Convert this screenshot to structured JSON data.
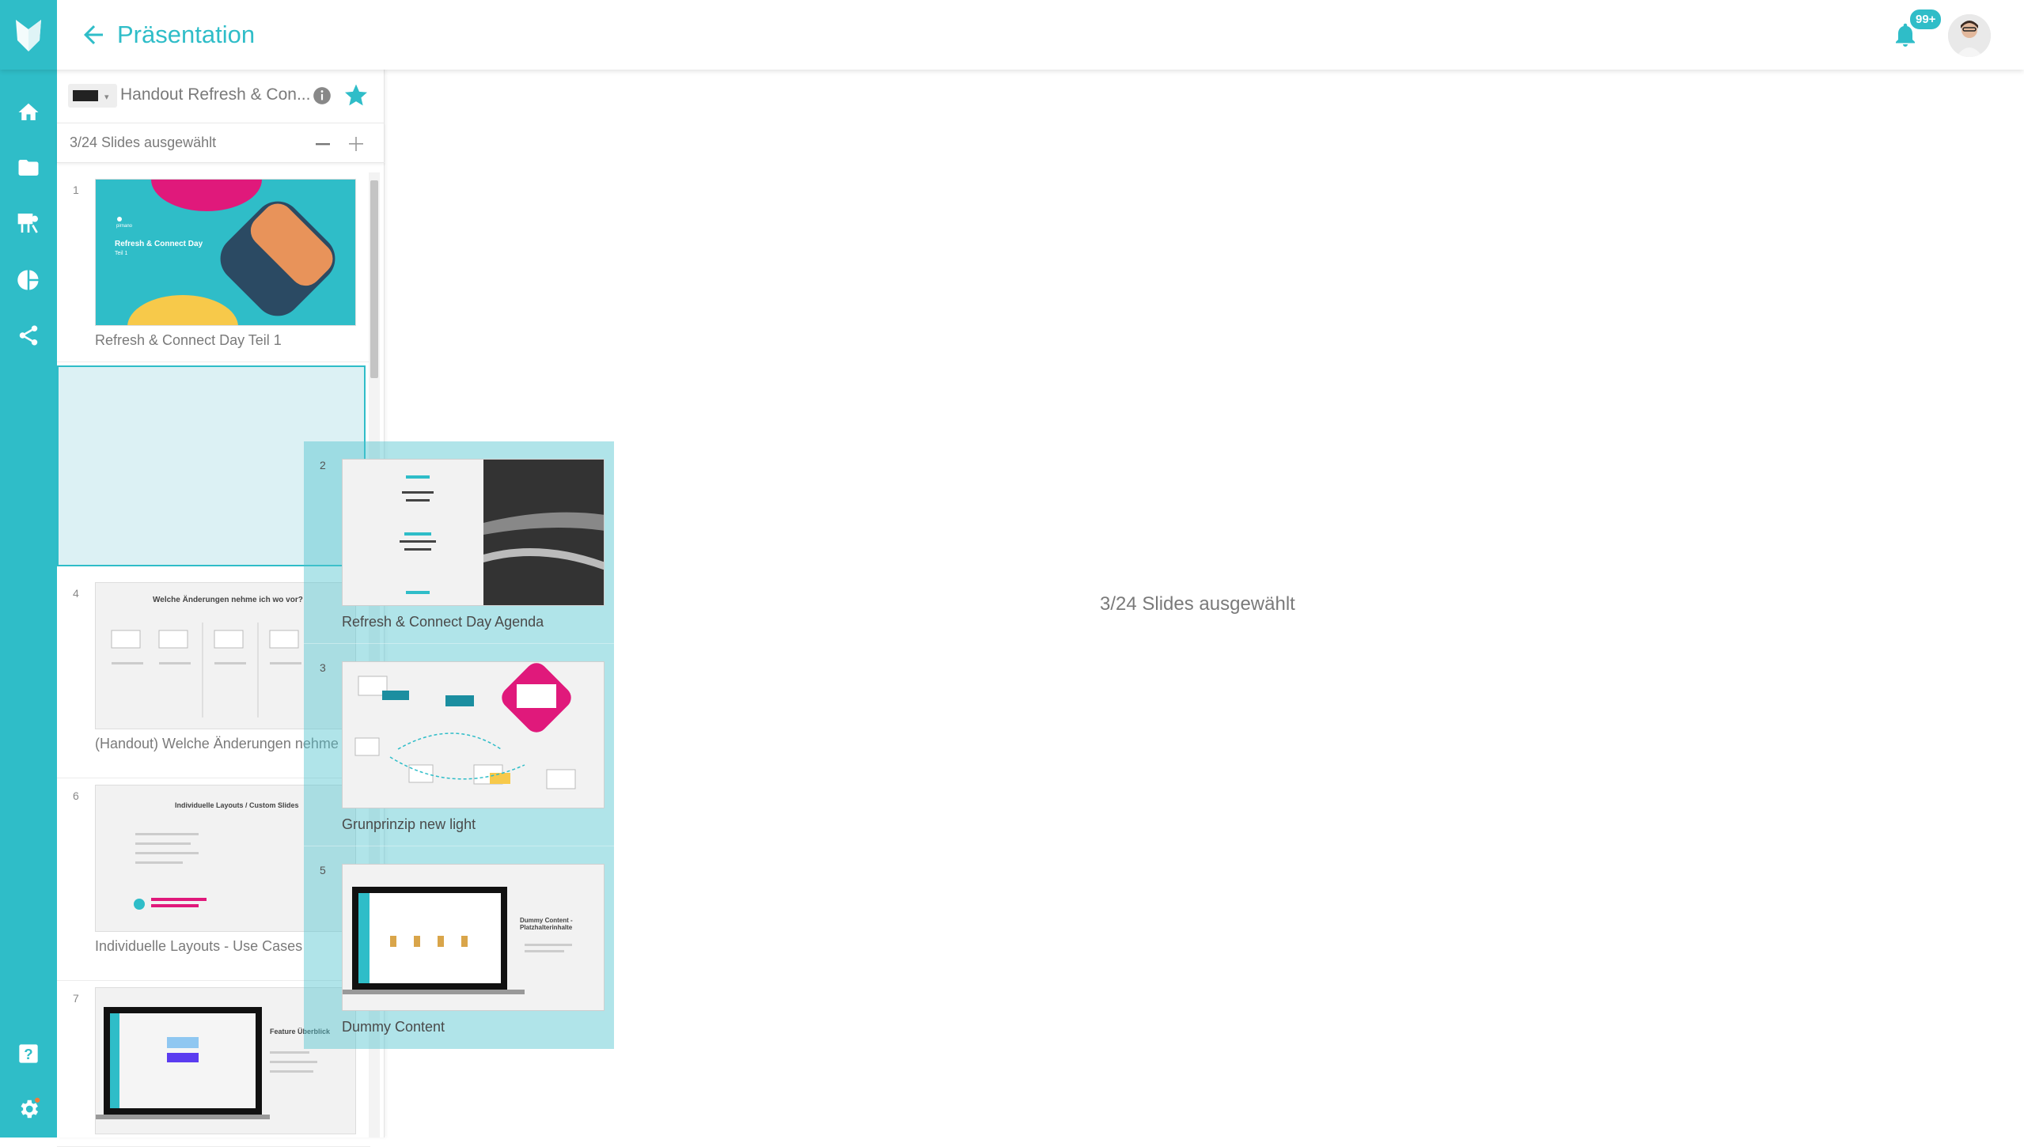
{
  "app": {
    "title": "Präsentation",
    "notification_badge": "99+",
    "accent": "#2fbdc8"
  },
  "sidebar": {
    "items": [
      {
        "name": "home-icon"
      },
      {
        "name": "folder-icon"
      },
      {
        "name": "presentation-icon"
      },
      {
        "name": "pie-chart-icon"
      },
      {
        "name": "share-icon"
      },
      {
        "name": "help-icon"
      },
      {
        "name": "settings-icon"
      }
    ]
  },
  "panel": {
    "presentation_name": "Handout Refresh & Con...",
    "selection_text": "3/24 Slides ausgewählt",
    "slides": [
      {
        "num": "1",
        "label": "Refresh & Connect Day Teil 1",
        "thumb_title": "Refresh & Connect Day",
        "thumb_sub": "Teil 1"
      },
      {
        "num": "4",
        "label": "(Handout) Welche Änderungen nehme i",
        "thumb_title": "Welche Änderungen nehme ich wo vor?"
      },
      {
        "num": "6",
        "label": "Individuelle Layouts - Use Cases",
        "thumb_title": "Individuelle Layouts / Custom Slides"
      },
      {
        "num": "7",
        "label": "",
        "thumb_title": "Feature Überblick"
      }
    ]
  },
  "drag": {
    "count": "3",
    "slides": [
      {
        "num": "2",
        "label": "Refresh & Connect Day Agenda"
      },
      {
        "num": "3",
        "label": "Grunprinzip new light"
      },
      {
        "num": "5",
        "label": "Dummy Content",
        "thumb_title": "Dummy Content - Platzhalterinhalte"
      }
    ]
  },
  "main": {
    "message": "3/24 Slides ausgewählt"
  }
}
